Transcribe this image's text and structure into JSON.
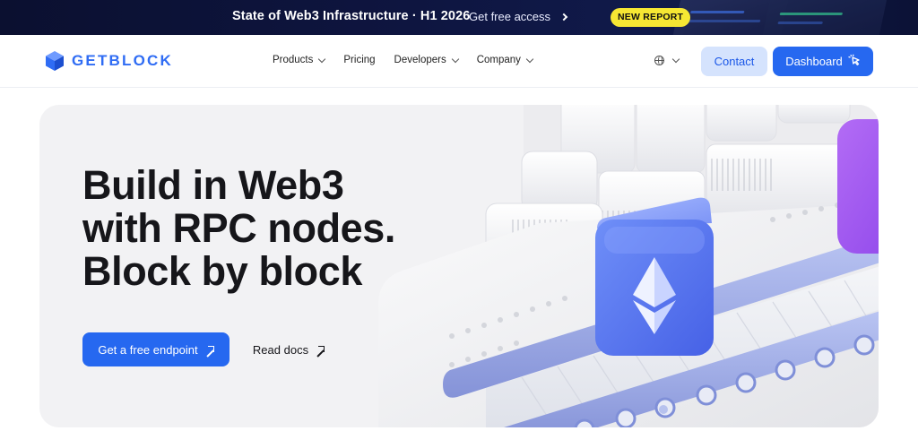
{
  "banner": {
    "title": "State of Web3 Infrastructure · H1 2026",
    "link_label": "Get free access",
    "badge": "NEW REPORT"
  },
  "nav": {
    "logo_text": "GETBLOCK",
    "items": [
      {
        "label": "Products",
        "has_dropdown": true
      },
      {
        "label": "Pricing",
        "has_dropdown": false
      },
      {
        "label": "Developers",
        "has_dropdown": true
      },
      {
        "label": "Company",
        "has_dropdown": true
      }
    ],
    "language_icon": "globe-icon",
    "contact_label": "Contact",
    "dashboard_label": "Dashboard"
  },
  "hero": {
    "title_lines": [
      "Build in Web3",
      "with RPC nodes.",
      "Block by block"
    ],
    "primary_cta": "Get a free endpoint",
    "secondary_cta": "Read docs"
  },
  "colors": {
    "brand": "#2668f0",
    "banner_bg": "#0e1540",
    "badge": "#f6e733",
    "hero_bg": "#f2f2f4",
    "contact_bg": "#d5e3fd"
  }
}
